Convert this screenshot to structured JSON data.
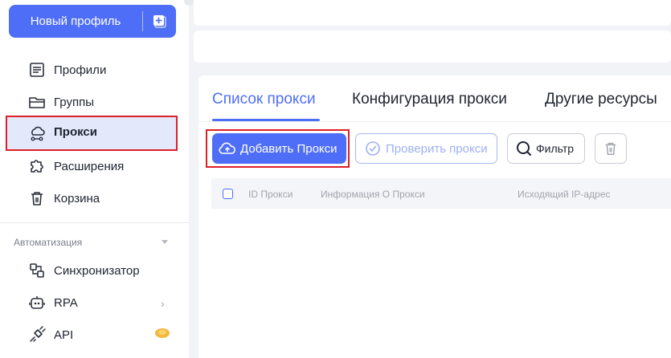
{
  "sidebar": {
    "new_profile_label": "Новый профиль",
    "items": [
      {
        "label": "Профили",
        "icon": "profile-list-icon"
      },
      {
        "label": "Группы",
        "icon": "folder-icon"
      },
      {
        "label": "Прокси",
        "icon": "proxy-network-icon",
        "active": true
      },
      {
        "label": "Расширения",
        "icon": "puzzle-icon"
      },
      {
        "label": "Корзина",
        "icon": "trash-icon"
      }
    ],
    "section_title": "Автоматизация",
    "automation_items": [
      {
        "label": "Синхронизатор",
        "icon": "sync-icon"
      },
      {
        "label": "RPA",
        "icon": "robot-icon"
      },
      {
        "label": "API",
        "icon": "api-plug-icon"
      }
    ]
  },
  "tabs": [
    {
      "label": "Список прокси",
      "active": true
    },
    {
      "label": "Конфигурация прокси"
    },
    {
      "label": "Другие ресурсы"
    }
  ],
  "toolbar": {
    "add_label": "Добавить Прокси",
    "check_label": "Проверить прокси",
    "filter_label": "Фильтр"
  },
  "table": {
    "columns": [
      "ID Прокси",
      "Информация О Прокси",
      "Исходящий IP-адрес"
    ]
  },
  "colors": {
    "accent": "#4f6ef7",
    "highlight_border": "#dd1f2a",
    "active_bg": "#e3e8fb"
  }
}
